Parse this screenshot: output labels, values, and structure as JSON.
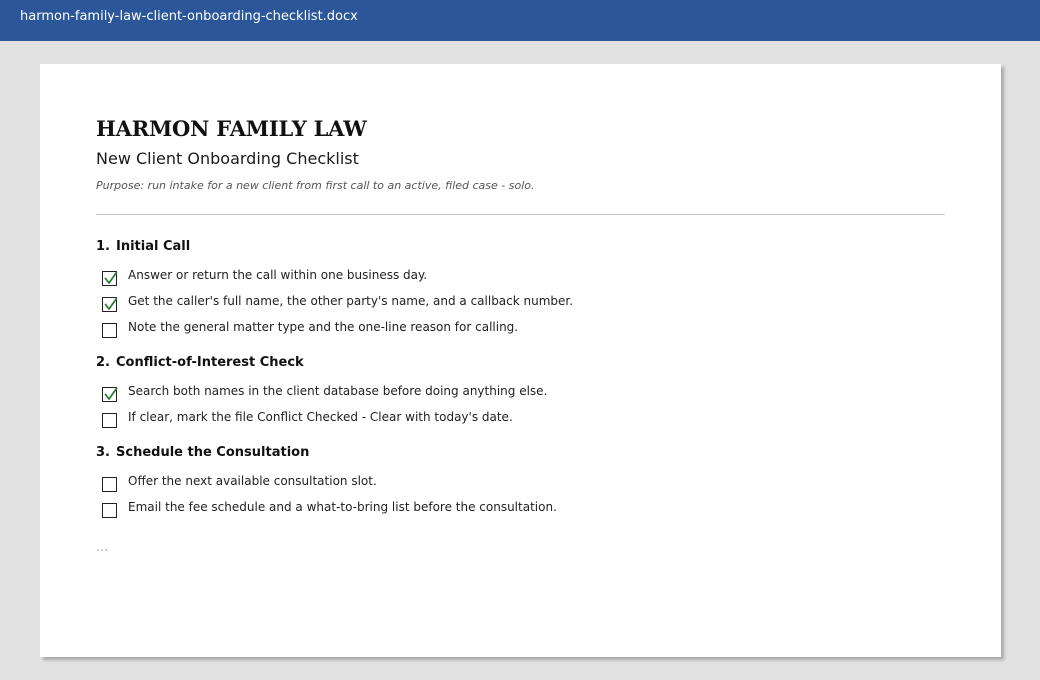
{
  "window": {
    "filename": "harmon-family-law-client-onboarding-checklist.docx"
  },
  "document": {
    "firm_name": "HARMON FAMILY LAW",
    "title": "New Client Onboarding Checklist",
    "purpose": "Purpose: run intake for a new client from first call to an active, filed case - solo.",
    "sections": [
      {
        "number": "1.",
        "heading": "Initial Call",
        "items": [
          {
            "label": "Answer or return the call within one business day.",
            "checked": true
          },
          {
            "label": "Get the caller's full name, the other party's name, and a callback number.",
            "checked": true
          },
          {
            "label": "Note the general matter type and the one-line reason for calling.",
            "checked": false
          }
        ]
      },
      {
        "number": "2.",
        "heading": "Conflict-of-Interest Check",
        "items": [
          {
            "label": "Search both names in the client database before doing anything else.",
            "checked": true
          },
          {
            "label": "If clear, mark the file Conflict Checked - Clear with today's date.",
            "checked": false
          }
        ]
      },
      {
        "number": "3.",
        "heading": "Schedule the Consultation",
        "items": [
          {
            "label": "Offer the next available consultation slot.",
            "checked": false
          },
          {
            "label": "Email the fee schedule and a what-to-bring list before the consultation.",
            "checked": false
          }
        ]
      }
    ],
    "continuation": "..."
  },
  "colors": {
    "titlebar": "#2b579a",
    "check_mark": "#2e7d32",
    "page": "#ffffff",
    "canvas": "#e1e1e1"
  }
}
